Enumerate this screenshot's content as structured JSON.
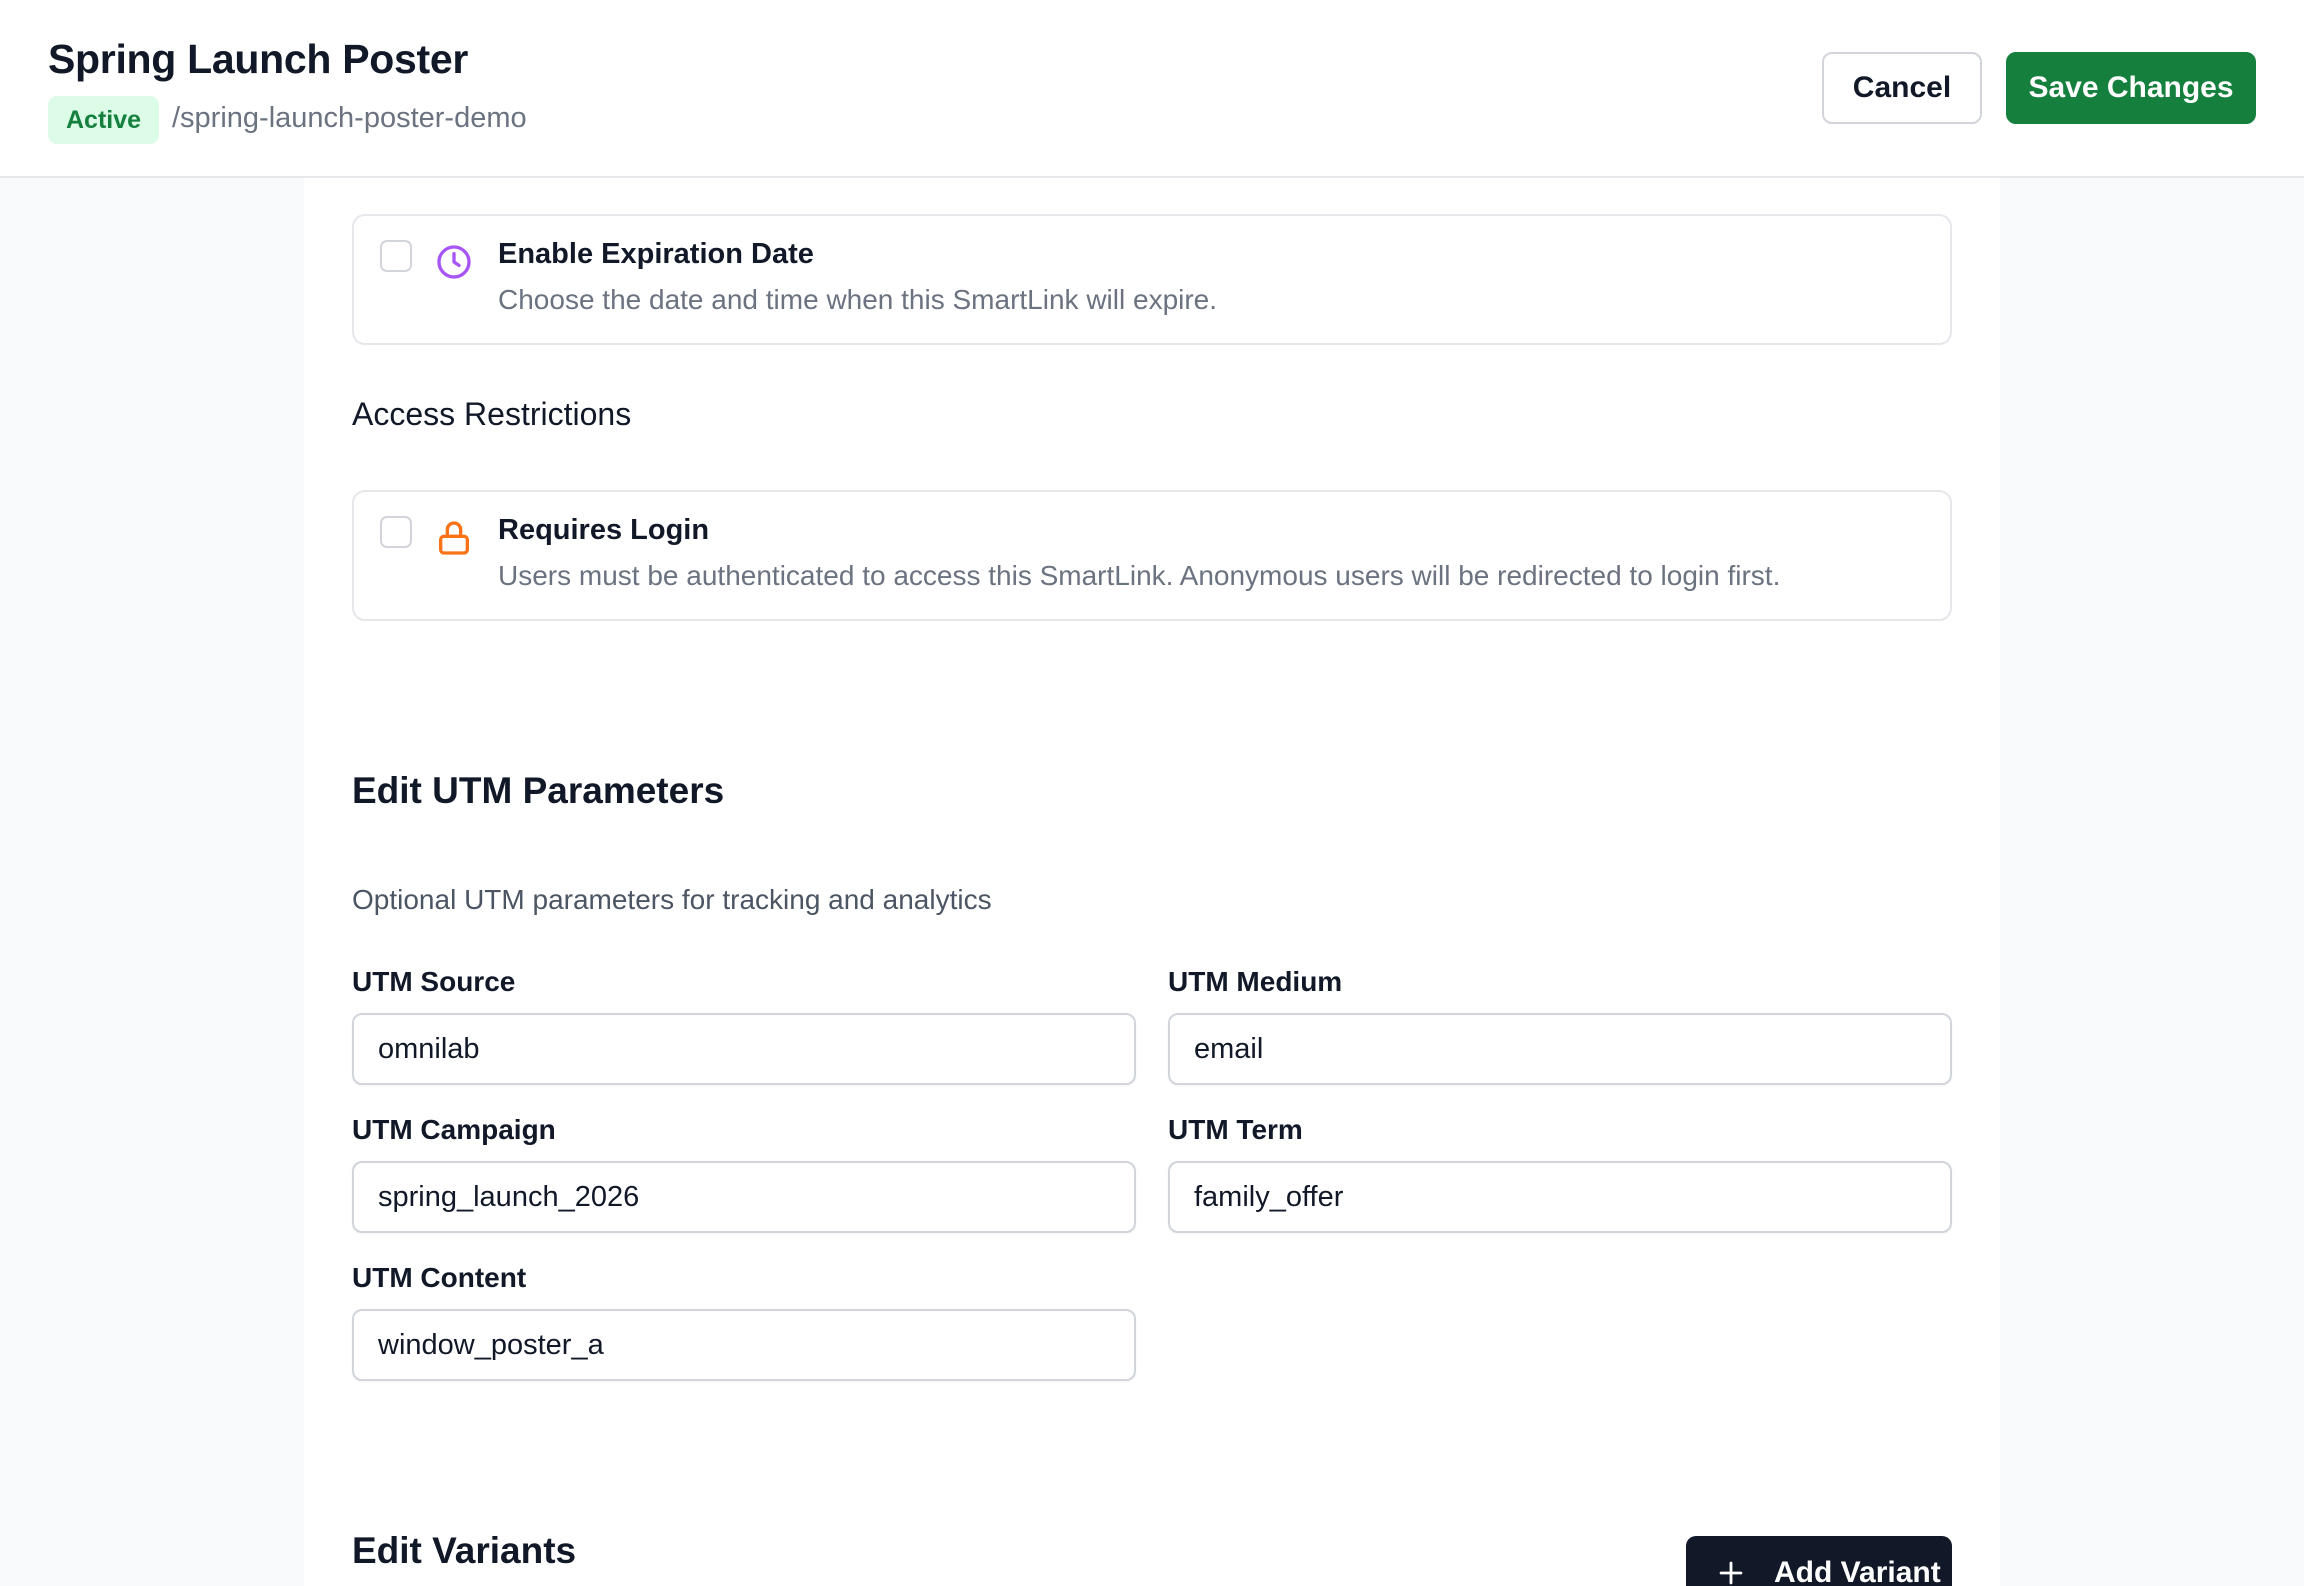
{
  "header": {
    "title": "Spring Launch Poster",
    "status_badge": "Active",
    "slug": "/spring-launch-poster-demo",
    "cancel_label": "Cancel",
    "save_label": "Save Changes"
  },
  "expiration": {
    "title": "Enable Expiration Date",
    "description": "Choose the date and time when this SmartLink will expire.",
    "checked": false,
    "icon": "clock-icon",
    "icon_color": "#a855f7"
  },
  "access": {
    "heading": "Access Restrictions",
    "title": "Requires Login",
    "description": "Users must be authenticated to access this SmartLink. Anonymous users will be redirected to login first.",
    "checked": false,
    "icon": "lock-icon",
    "icon_color": "#f97316"
  },
  "utm": {
    "heading": "Edit UTM Parameters",
    "description": "Optional UTM parameters for tracking and analytics",
    "source": {
      "label": "UTM Source",
      "value": "omnilab"
    },
    "medium": {
      "label": "UTM Medium",
      "value": "email"
    },
    "campaign": {
      "label": "UTM Campaign",
      "value": "spring_launch_2026"
    },
    "term": {
      "label": "UTM Term",
      "value": "family_offer"
    },
    "content": {
      "label": "UTM Content",
      "value": "window_poster_a"
    }
  },
  "variants": {
    "heading": "Edit Variants",
    "add_label": "Add Variant"
  },
  "colors": {
    "brand_green": "#15803d",
    "badge_bg": "#dcfce7",
    "dark_button": "#111827"
  }
}
